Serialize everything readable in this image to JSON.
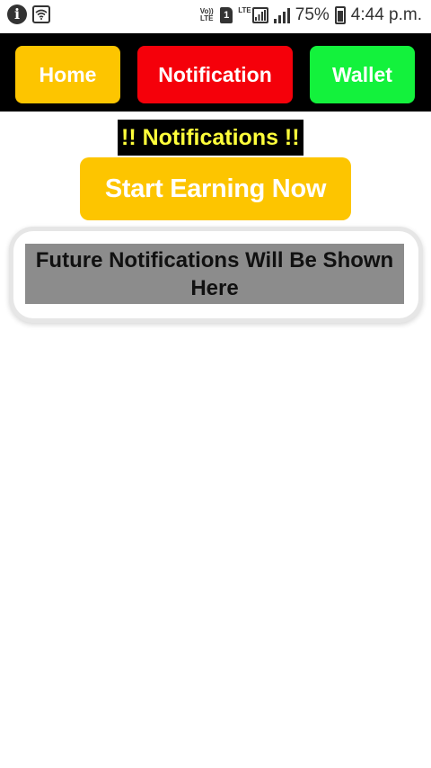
{
  "status_bar": {
    "volte_label": "Vo)) LTE",
    "sim_label": "1",
    "lte_label": "LTE",
    "battery_percent": "75%",
    "time": "4:44 p.m.",
    "icons": [
      "info-icon",
      "wifi-icon",
      "volte-icon",
      "sim-icon",
      "lte-signal-icon",
      "signal-icon",
      "battery-icon"
    ]
  },
  "nav": {
    "home_label": "Home",
    "notification_label": "Notification",
    "wallet_label": "Wallet"
  },
  "main": {
    "heading": "!! Notifications !!",
    "start_button_label": "Start Earning Now",
    "notification_message": "Future Notifications Will Be Shown Here"
  },
  "colors": {
    "home_bg": "#fdc500",
    "notification_bg": "#f5000a",
    "wallet_bg": "#13f23c",
    "heading_text": "#fdfd3a",
    "start_button_bg": "#fdc500",
    "card_inner_bg": "#8c8c8c"
  }
}
